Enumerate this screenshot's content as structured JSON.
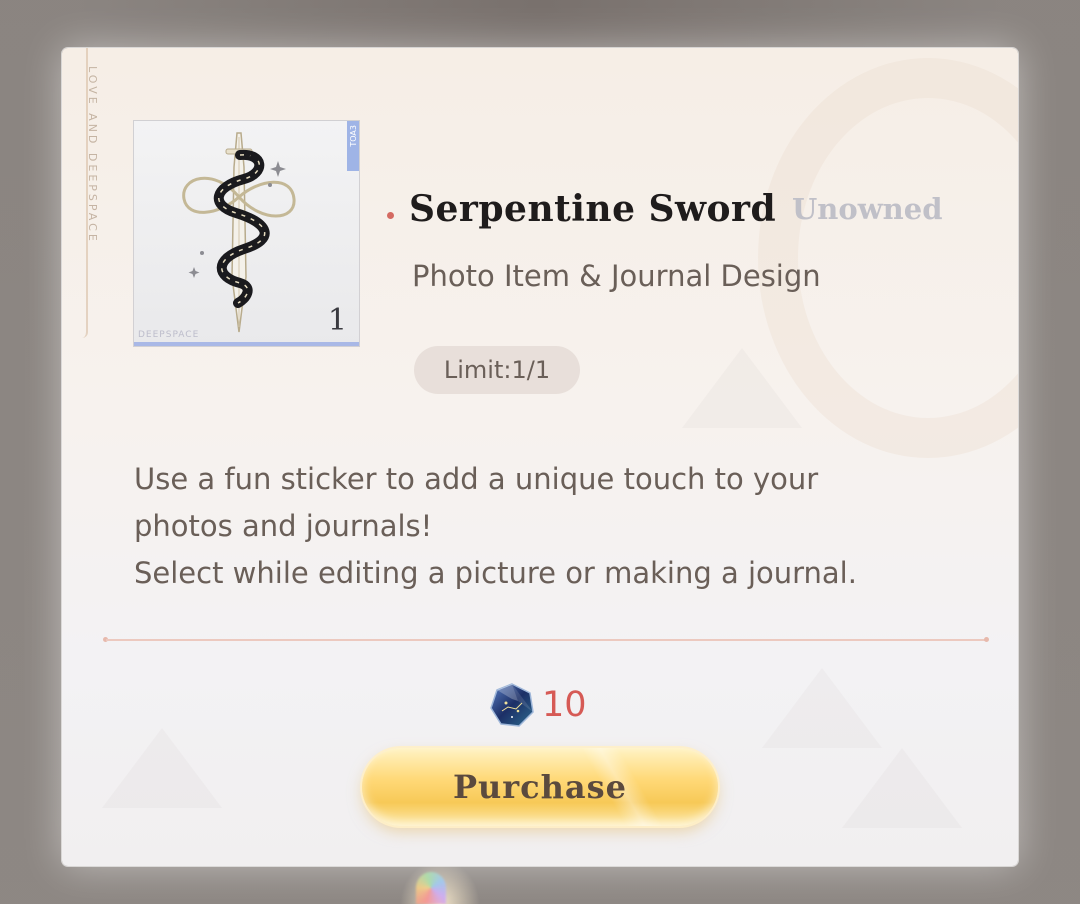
{
  "background_brand": "LOVE AND DEEPSPACE",
  "item": {
    "title": "Serpentine Sword",
    "status": "Unowned",
    "subtitle": "Photo Item & Journal Design",
    "limit": "Limit:1/1",
    "count": "1",
    "card_tag": "TOA3",
    "card_brand": "DEEPSPACE",
    "art_icon": "serpent-sword-sticker",
    "description": [
      "Use a fun sticker to add a unique touch to your",
      "photos and journals!",
      "Select while editing a picture or making a journal."
    ]
  },
  "price": {
    "currency_icon": "deepspace-gem-icon",
    "amount": "10"
  },
  "actions": {
    "purchase_label": "Purchase"
  },
  "colors": {
    "accent_red": "#d65a55",
    "button_gold": "#ffd978",
    "text_brown": "#6a5f58",
    "status_gray": "#c0c0c8"
  }
}
